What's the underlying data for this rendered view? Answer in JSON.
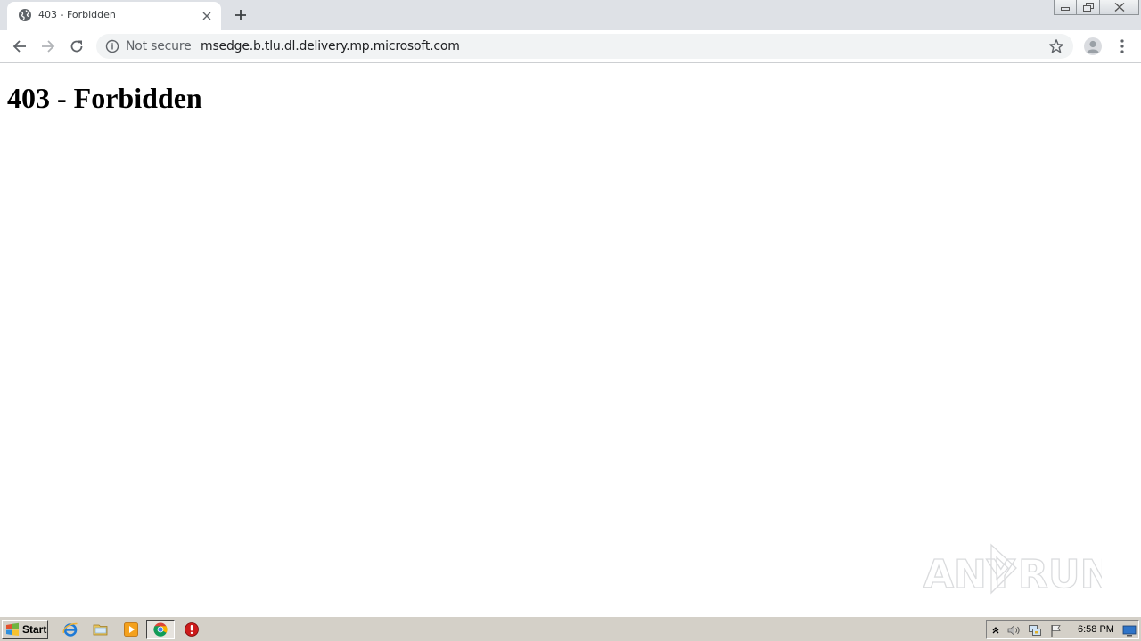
{
  "browser": {
    "tab": {
      "title": "403 - Forbidden",
      "favicon": "globe-icon"
    },
    "new_tab_icon": "plus-icon",
    "window_controls": [
      "minimize-icon",
      "restore-icon",
      "close-icon"
    ],
    "toolbar": {
      "back_icon": "arrow-left-icon",
      "forward_icon": "arrow-right-icon",
      "reload_icon": "reload-icon",
      "security_label": "Not secure",
      "url": "msedge.b.tlu.dl.delivery.mp.microsoft.com",
      "bookmark_icon": "star-icon",
      "profile_icon": "avatar-icon",
      "menu_icon": "kebab-menu-icon"
    }
  },
  "page": {
    "heading": "403 - Forbidden"
  },
  "watermark": {
    "text_left": "ANY",
    "text_right": "RUN"
  },
  "taskbar": {
    "start_label": "Start",
    "quick_launch": [
      "ie-icon",
      "folder-icon",
      "media-player-icon",
      "chrome-icon",
      "stop-icon"
    ],
    "clock": "6:58 PM"
  },
  "colors": {
    "tabstrip": "#dee1e6",
    "omnibox": "#f1f3f4",
    "taskbar": "#d4d0c8"
  }
}
